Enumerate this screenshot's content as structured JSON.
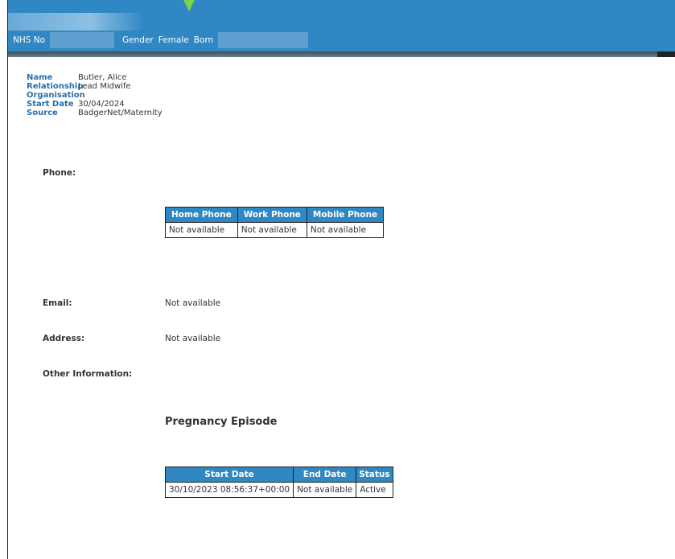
{
  "banner": {
    "nhs_label": "NHS No",
    "gender_label": "Gender",
    "gender_value": "Female",
    "born_label": "Born"
  },
  "details": [
    {
      "key": "Name",
      "value": "Butler, Alice"
    },
    {
      "key": "Relationship",
      "value": "Lead Midwife"
    },
    {
      "key": "Organisation",
      "value": ""
    },
    {
      "key": "Start Date",
      "value": "30/04/2024"
    },
    {
      "key": "Source",
      "value": "BadgerNet/Maternity"
    }
  ],
  "phone": {
    "label": "Phone:",
    "headers": [
      "Home Phone",
      "Work Phone",
      "Mobile Phone"
    ],
    "row": [
      "Not available",
      "Not available",
      "Not available"
    ]
  },
  "email": {
    "label": "Email:",
    "value": "Not available"
  },
  "address": {
    "label": "Address:",
    "value": "Not available"
  },
  "other": {
    "label": "Other Information:"
  },
  "pregnancy": {
    "heading": "Pregnancy Episode",
    "headers": [
      "Start Date",
      "End Date",
      "Status"
    ],
    "row": [
      "30/10/2023 08:56:37+00:00",
      "Not available",
      "Active"
    ]
  }
}
